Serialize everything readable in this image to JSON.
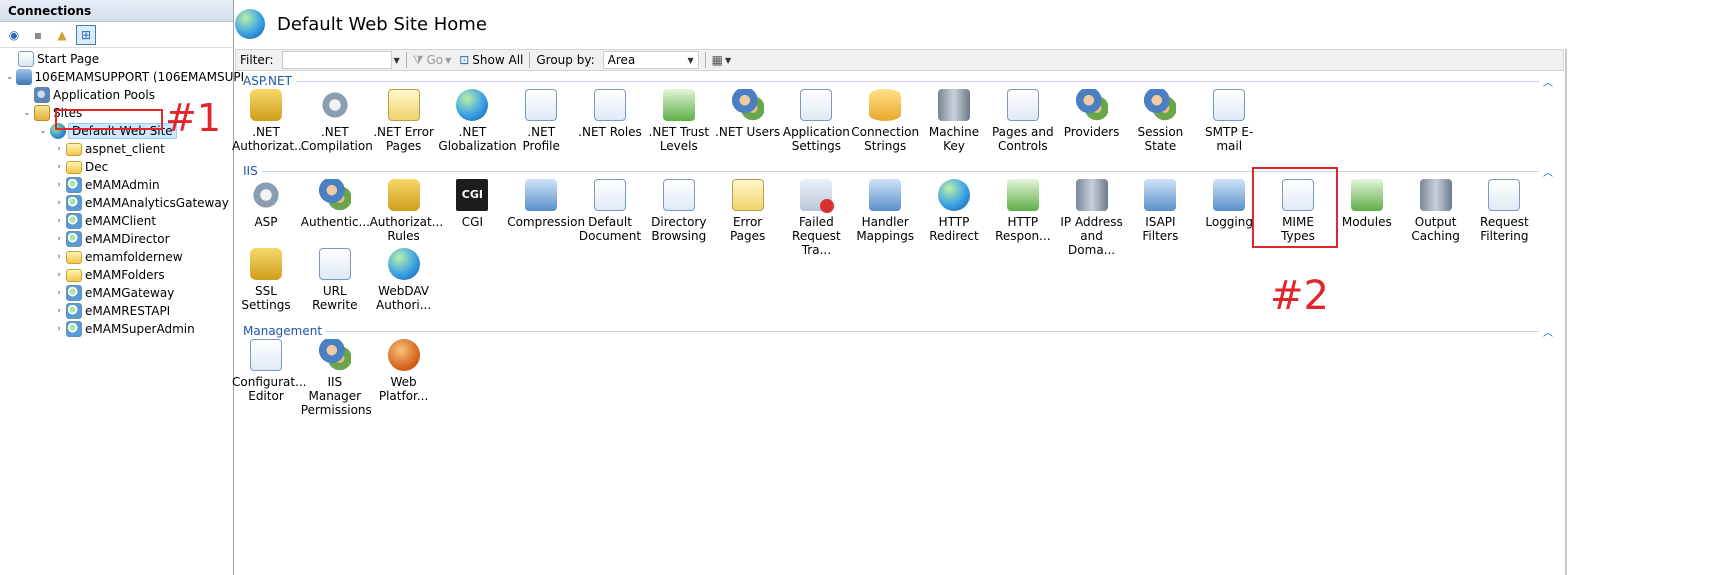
{
  "connections": {
    "header": "Connections",
    "toolbar": [
      "globe-connect-icon",
      "save-icon",
      "up-folder-icon",
      "network-icon"
    ],
    "tree": [
      {
        "label": "Start Page",
        "indent": 0,
        "icon": "page",
        "twisty": ""
      },
      {
        "label": "106EMAMSUPPORT (106EMAMSUPI",
        "indent": 0,
        "icon": "server",
        "twisty": "v"
      },
      {
        "label": "Application Pools",
        "indent": 1,
        "icon": "pool",
        "twisty": ""
      },
      {
        "label": "Sites",
        "indent": 1,
        "icon": "sites",
        "twisty": "v"
      },
      {
        "label": "Default Web Site",
        "indent": 2,
        "icon": "globe",
        "twisty": "v",
        "selected": true
      },
      {
        "label": "aspnet_client",
        "indent": 3,
        "icon": "folder",
        "twisty": ">"
      },
      {
        "label": "Dec",
        "indent": 3,
        "icon": "folder",
        "twisty": ">"
      },
      {
        "label": "eMAMAdmin",
        "indent": 3,
        "icon": "app",
        "twisty": ">"
      },
      {
        "label": "eMAMAnalyticsGateway",
        "indent": 3,
        "icon": "app",
        "twisty": ">"
      },
      {
        "label": "eMAMClient",
        "indent": 3,
        "icon": "app",
        "twisty": ">"
      },
      {
        "label": "eMAMDirector",
        "indent": 3,
        "icon": "app",
        "twisty": ">"
      },
      {
        "label": "emamfoldernew",
        "indent": 3,
        "icon": "folder",
        "twisty": ">"
      },
      {
        "label": "eMAMFolders",
        "indent": 3,
        "icon": "folder",
        "twisty": ">"
      },
      {
        "label": "eMAMGateway",
        "indent": 3,
        "icon": "app",
        "twisty": ">"
      },
      {
        "label": "eMAMRESTAPI",
        "indent": 3,
        "icon": "app",
        "twisty": ">"
      },
      {
        "label": "eMAMSuperAdmin",
        "indent": 3,
        "icon": "app",
        "twisty": ">"
      }
    ]
  },
  "annotations": {
    "one": "#1",
    "two": "#2"
  },
  "main": {
    "title": "Default Web Site Home",
    "filter": {
      "label": "Filter:",
      "value": "",
      "go": "Go",
      "show_all": "Show All",
      "group_by_label": "Group by:",
      "group_by_value": "Area"
    },
    "groups": [
      {
        "name": "ASP.NET",
        "features": [
          {
            "line1": ".NET",
            "line2": "Authorizat...",
            "icon": "lock"
          },
          {
            "line1": ".NET",
            "line2": "Compilation",
            "icon": "gear"
          },
          {
            "line1": ".NET Error",
            "line2": "Pages",
            "icon": "warn"
          },
          {
            "line1": ".NET",
            "line2": "Globalization",
            "icon": "globe"
          },
          {
            "line1": ".NET Profile",
            "line2": "",
            "icon": "doc"
          },
          {
            "line1": ".NET Roles",
            "line2": "",
            "icon": "doc"
          },
          {
            "line1": ".NET Trust",
            "line2": "Levels",
            "icon": "green"
          },
          {
            "line1": ".NET Users",
            "line2": "",
            "icon": "users"
          },
          {
            "line1": "Application",
            "line2": "Settings",
            "icon": "doc"
          },
          {
            "line1": "Connection",
            "line2": "Strings",
            "icon": "db"
          },
          {
            "line1": "Machine Key",
            "line2": "",
            "icon": "server"
          },
          {
            "line1": "Pages and",
            "line2": "Controls",
            "icon": "doc"
          },
          {
            "line1": "Providers",
            "line2": "",
            "icon": "users"
          },
          {
            "line1": "Session State",
            "line2": "",
            "icon": "users"
          },
          {
            "line1": "SMTP E-mail",
            "line2": "",
            "icon": "doc"
          }
        ]
      },
      {
        "name": "IIS",
        "features": [
          {
            "line1": "ASP",
            "line2": "",
            "icon": "gear"
          },
          {
            "line1": "Authentic...",
            "line2": "",
            "icon": "users"
          },
          {
            "line1": "Authorizat...",
            "line2": "Rules",
            "icon": "lock"
          },
          {
            "line1": "CGI",
            "line2": "",
            "icon": "cgi"
          },
          {
            "line1": "Compression",
            "line2": "",
            "icon": "blue"
          },
          {
            "line1": "Default",
            "line2": "Document",
            "icon": "doc"
          },
          {
            "line1": "Directory",
            "line2": "Browsing",
            "icon": "doc"
          },
          {
            "line1": "Error Pages",
            "line2": "",
            "icon": "warn"
          },
          {
            "line1": "Failed",
            "line2": "Request Tra...",
            "icon": "red"
          },
          {
            "line1": "Handler",
            "line2": "Mappings",
            "icon": "blue"
          },
          {
            "line1": "HTTP",
            "line2": "Redirect",
            "icon": "globe"
          },
          {
            "line1": "HTTP",
            "line2": "Respon...",
            "icon": "green"
          },
          {
            "line1": "IP Address",
            "line2": "and Doma...",
            "icon": "server"
          },
          {
            "line1": "ISAPI Filters",
            "line2": "",
            "icon": "blue"
          },
          {
            "line1": "Logging",
            "line2": "",
            "icon": "blue"
          },
          {
            "line1": "MIME Types",
            "line2": "",
            "icon": "doc"
          },
          {
            "line1": "Modules",
            "line2": "",
            "icon": "green"
          },
          {
            "line1": "Output",
            "line2": "Caching",
            "icon": "server"
          },
          {
            "line1": "Request",
            "line2": "Filtering",
            "icon": "doc"
          },
          {
            "line1": "SSL Settings",
            "line2": "",
            "icon": "lock"
          },
          {
            "line1": "URL Rewrite",
            "line2": "",
            "icon": "doc"
          },
          {
            "line1": "WebDAV",
            "line2": "Authori...",
            "icon": "dav"
          }
        ]
      },
      {
        "name": "Management",
        "features": [
          {
            "line1": "Configurat...",
            "line2": "Editor",
            "icon": "doc"
          },
          {
            "line1": "IIS Manager",
            "line2": "Permissions",
            "icon": "users"
          },
          {
            "line1": "Web",
            "line2": "Platfor...",
            "icon": "orange"
          }
        ]
      }
    ]
  }
}
